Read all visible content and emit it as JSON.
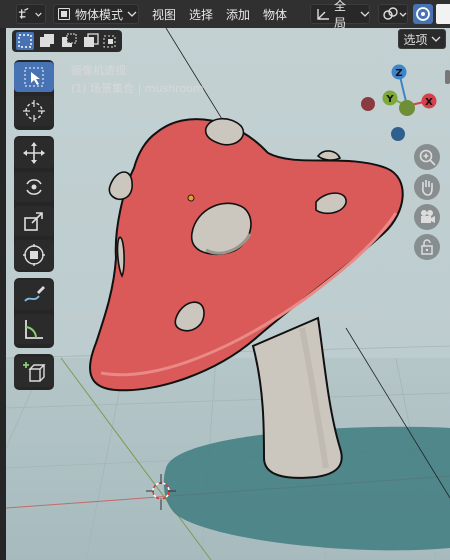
{
  "header": {
    "mode_label": "物体模式",
    "menus": [
      "视图",
      "选择",
      "添加",
      "物体"
    ],
    "transform_orientation": "全局"
  },
  "viewport": {
    "options_label": "选项",
    "view_name": "摄像机透视",
    "collection_label": "(1) 场景集合 | mushroom",
    "gizmo_axes": {
      "z": "Z",
      "y": "Y",
      "x": "X"
    }
  },
  "icons": {
    "toolbar": [
      "select-box-icon",
      "cursor-icon",
      "move-icon",
      "rotate-icon",
      "scale-icon",
      "transform-icon",
      "annotate-icon",
      "measure-icon",
      "add-cube-icon"
    ],
    "nav": [
      "zoom-icon",
      "hand-pan-icon",
      "camera-icon",
      "lock-icon"
    ]
  },
  "colors": {
    "cap": "#d95a58",
    "cap_dark": "#b84848",
    "spots": "#cbc6be",
    "stem": "#cbc6be",
    "shadow": "#3f7c80",
    "ground": "#5a6668",
    "active_tool": "#4772b3",
    "axis_x": "#d6404a",
    "axis_y": "#7ea93a",
    "axis_z": "#3f84c8"
  }
}
